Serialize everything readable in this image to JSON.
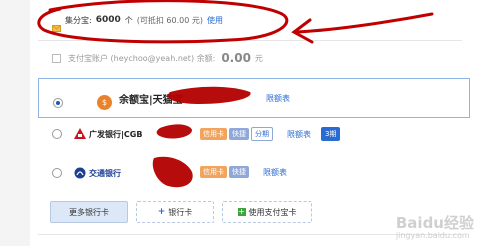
{
  "points": {
    "label": "集分宝:",
    "count": "6000",
    "unit": "个",
    "deduct": "(可抵扣 60.00 元)",
    "use_link": "使用"
  },
  "alipay": {
    "label": "支付宝账户 (heychoo@yeah.net) 余额:",
    "balance": "0.00",
    "unit": "元"
  },
  "payment_options": [
    {
      "name": "余额宝|天猫宝",
      "limit_link": "限额表",
      "selected": true
    },
    {
      "name": "广发银行|CGB",
      "tags": [
        "信用卡",
        "快捷",
        "分期"
      ],
      "limit_link": "限额表",
      "promo": "3期"
    },
    {
      "name": "交通银行",
      "tags": [
        "信用卡",
        "快捷"
      ],
      "limit_link": "限额表"
    }
  ],
  "buttons": {
    "more_cards": "更多银行卡",
    "add_card": "银行卡",
    "use_alipay_card": "使用支付宝卡"
  },
  "watermark": {
    "text": "Baidu经验",
    "sub": "jingyan.baidu.com"
  },
  "colors": {
    "link": "#2a6bd3",
    "selected_border": "#8fb4e6",
    "annotation": "#c00000"
  }
}
